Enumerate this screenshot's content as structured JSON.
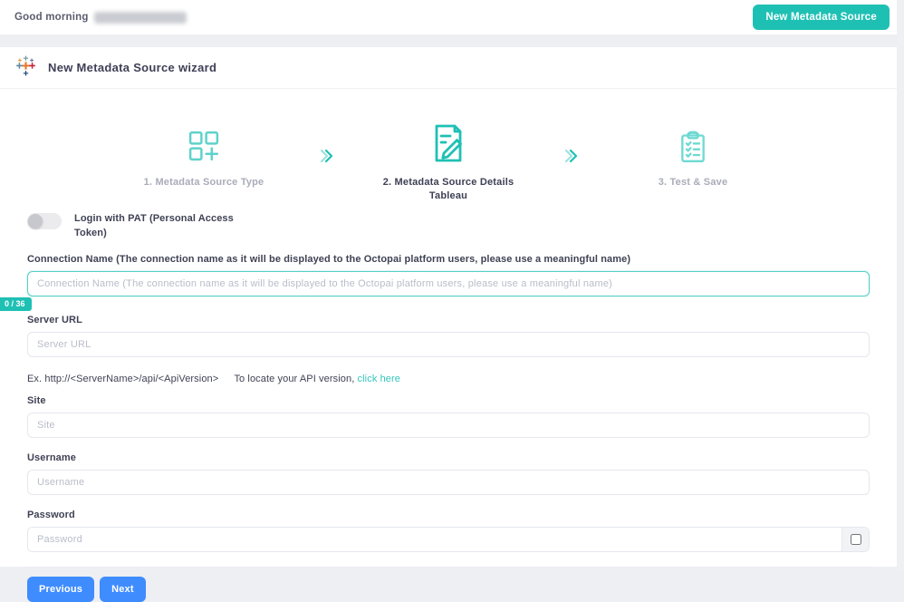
{
  "header": {
    "greeting": "Good morning",
    "new_source_button": "New Metadata Source"
  },
  "wizard": {
    "title": "New Metadata Source wizard",
    "steps": [
      {
        "label": "1. Metadata Source Type"
      },
      {
        "label": "2. Metadata Source Details",
        "sublabel": "Tableau"
      },
      {
        "label": "3. Test & Save"
      }
    ]
  },
  "form": {
    "pat_toggle_label": "Login with PAT (Personal Access Token)",
    "connection_name": {
      "label": "Connection Name (The connection name as it will be displayed to the Octopai platform users, please use a meaningful name)",
      "placeholder": "Connection Name (The connection name as it will be displayed to the Octopai platform users, please use a meaningful name)",
      "counter": "0 / 36"
    },
    "server_url": {
      "label": "Server URL",
      "placeholder": "Server URL",
      "helper_example": "Ex. http://<ServerName>/api/<ApiVersion>",
      "helper_text": "To locate your API version,",
      "helper_link": "click here"
    },
    "site": {
      "label": "Site",
      "placeholder": "Site"
    },
    "username": {
      "label": "Username",
      "placeholder": "Username"
    },
    "password": {
      "label": "Password",
      "placeholder": "Password"
    }
  },
  "actions": {
    "previous": "Previous",
    "next": "Next"
  },
  "colors": {
    "accent_teal": "#1fc0b4",
    "primary_blue": "#3f8cfe",
    "page_background": "#edeff3"
  }
}
